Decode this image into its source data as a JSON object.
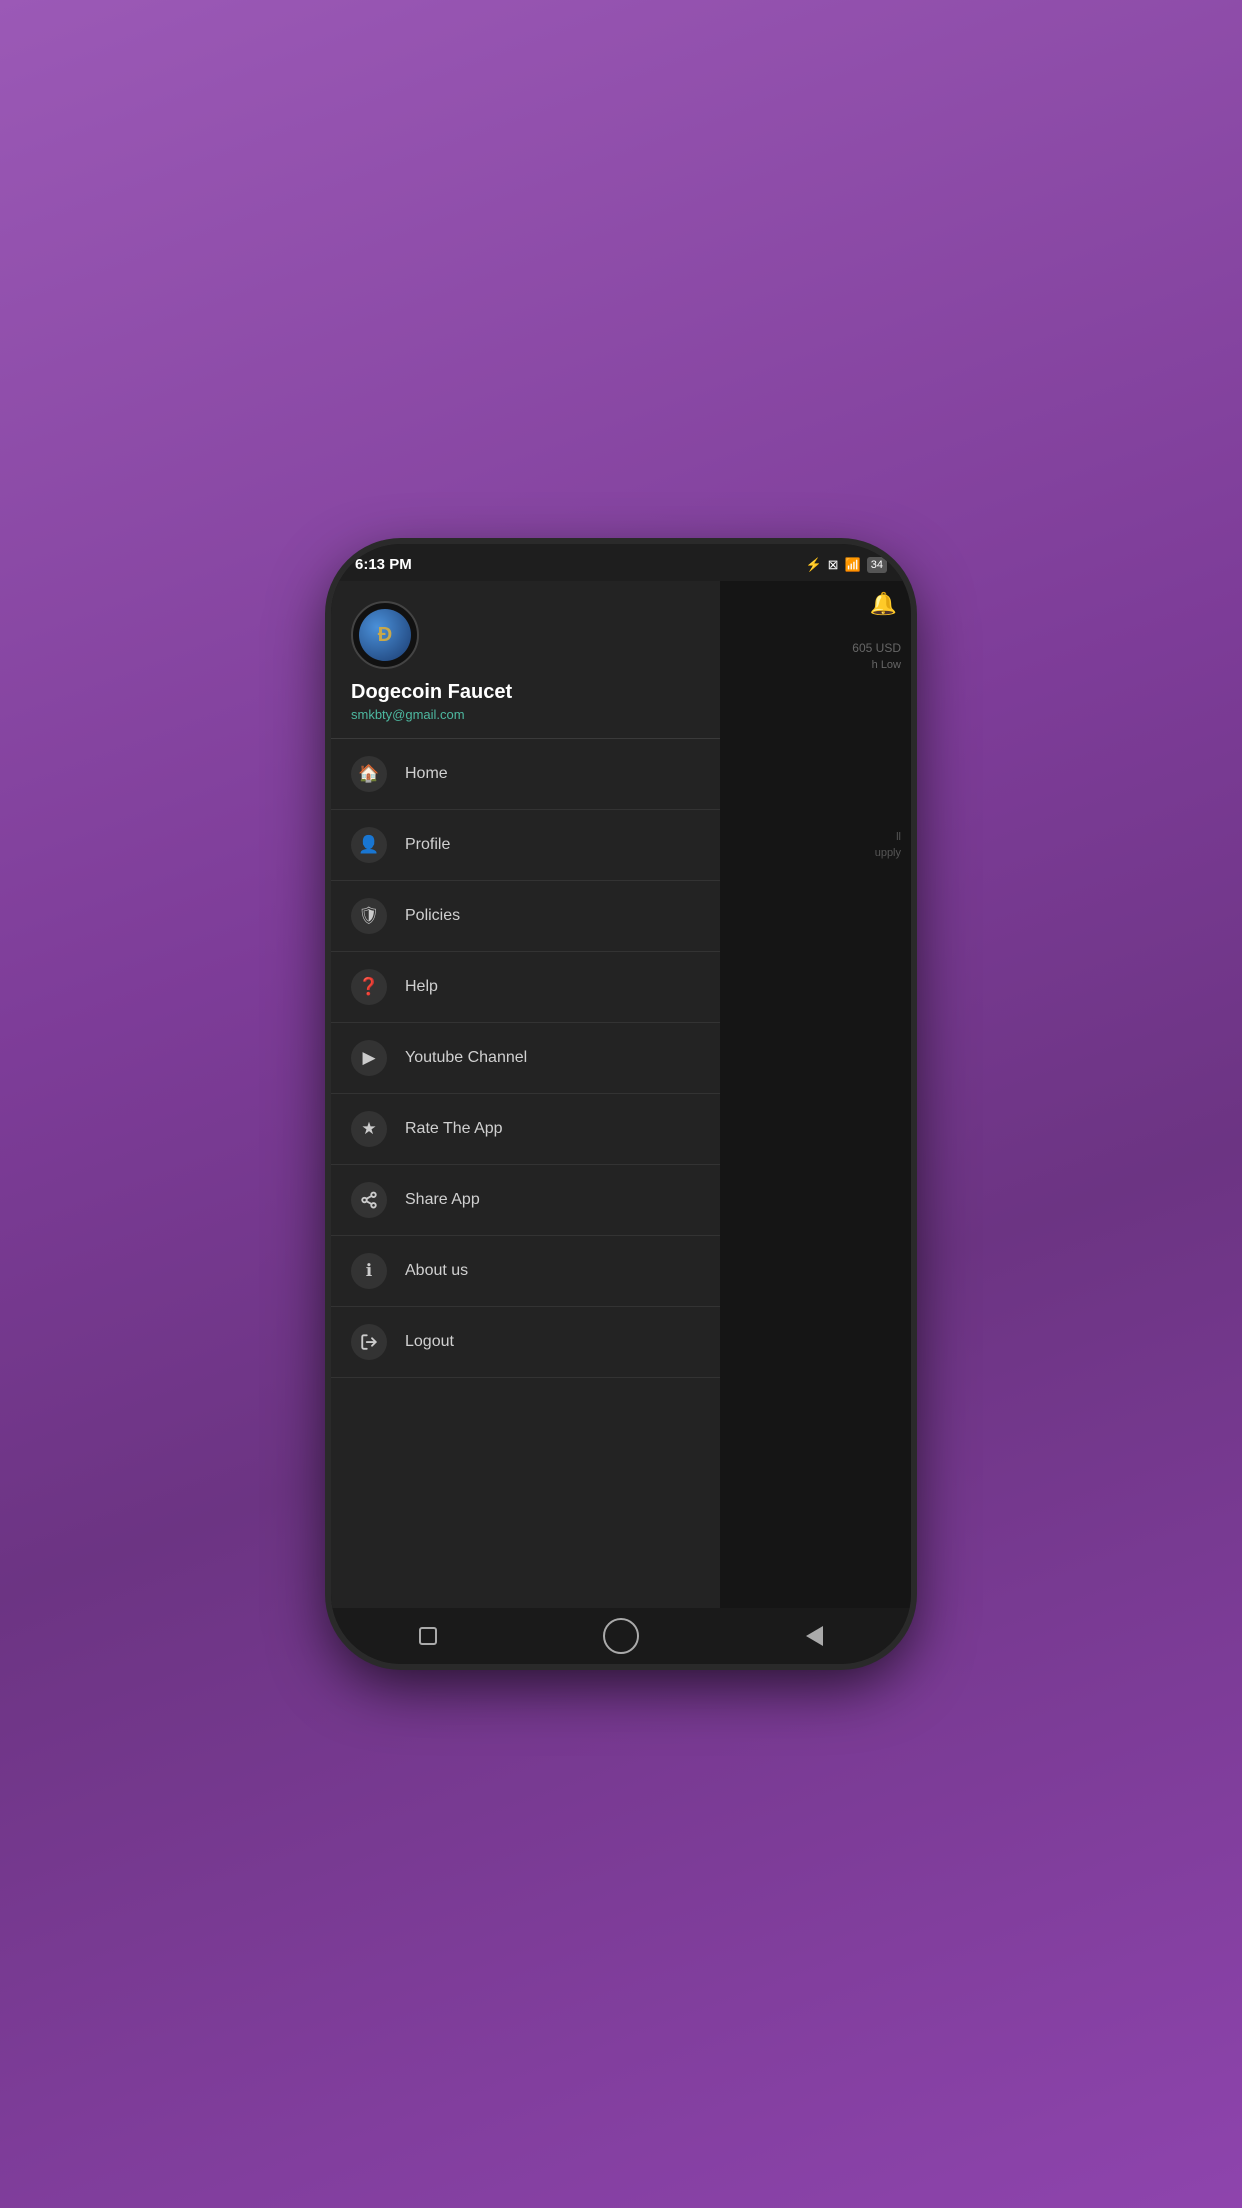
{
  "status_bar": {
    "time": "6:13 PM",
    "bluetooth": "⚡",
    "battery_text": "34"
  },
  "drawer": {
    "app_name": "Dogecoin Faucet",
    "email": "smkbty@gmail.com",
    "balance_partial": "605 USD",
    "balance_level": "h Low"
  },
  "menu_items": [
    {
      "id": "home",
      "label": "Home",
      "icon": "🏠"
    },
    {
      "id": "profile",
      "label": "Profile",
      "icon": "👤"
    },
    {
      "id": "policies",
      "label": "Policies",
      "icon": "🛡"
    },
    {
      "id": "help",
      "label": "Help",
      "icon": "❓"
    },
    {
      "id": "youtube",
      "label": "Youtube Channel",
      "icon": "▶"
    },
    {
      "id": "rate",
      "label": "Rate The App",
      "icon": "★"
    },
    {
      "id": "share",
      "label": "Share App",
      "icon": "↗"
    },
    {
      "id": "about",
      "label": "About us",
      "icon": "ℹ"
    },
    {
      "id": "logout",
      "label": "Logout",
      "icon": "⇥"
    }
  ],
  "bg_content": {
    "partial_balance": "605 USD",
    "partial_label": "h Low",
    "partial_text3": "ll",
    "partial_text4": "upply"
  }
}
